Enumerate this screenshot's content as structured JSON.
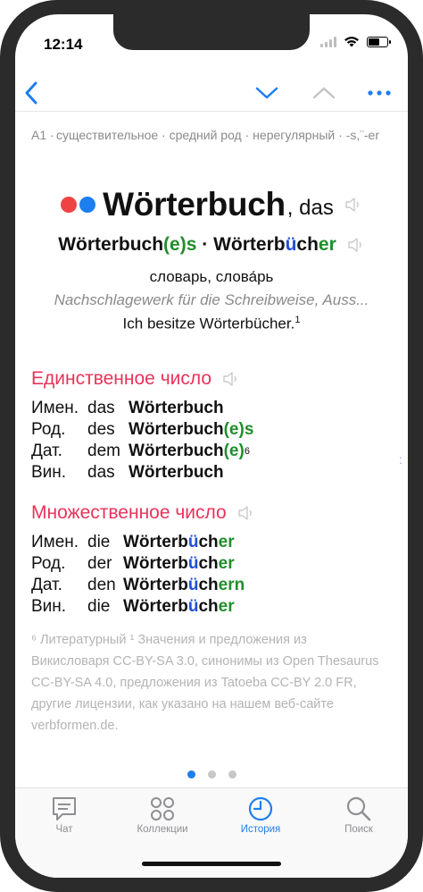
{
  "status_bar": {
    "time": "12:14"
  },
  "entry": {
    "level": "A1 ·",
    "grammar": "существительное · средний род · нерегулярный · -s,¨-er",
    "dots": {
      "left": "#ef4343",
      "right": "#1e7ef0"
    },
    "word": "Wörterbuch",
    "article": ", das",
    "forms": {
      "sg_base": "Wörterbuch",
      "sg_ending": "(e)s",
      "separator": " · ",
      "pl_start": "Wörterb",
      "pl_umlaut": "ü",
      "pl_mid": "ch",
      "pl_ending": "er"
    },
    "translation": "словарь, слова́рь",
    "definition": "Nachschlagewerk für die Schreibweise, Auss...",
    "example": "Ich besitze Wörterbücher.",
    "example_sup": "1"
  },
  "singular": {
    "title": "Единственное число",
    "rows": [
      {
        "case": "Имен.",
        "article": "das",
        "noun": "Wörterbuch",
        "ending": "",
        "sup": ""
      },
      {
        "case": "Род.",
        "article": "des",
        "noun": "Wörterbuch",
        "ending": "(e)s",
        "sup": ""
      },
      {
        "case": "Дат.",
        "article": "dem",
        "noun": "Wörterbuch",
        "ending": "(e)",
        "sup": "6"
      },
      {
        "case": "Вин.",
        "article": "das",
        "noun": "Wörterbuch",
        "ending": "",
        "sup": ""
      }
    ]
  },
  "plural": {
    "title": "Множественное число",
    "rows": [
      {
        "case": "Имен.",
        "article": "die",
        "stem": "Wörterb",
        "umlaut": "ü",
        "mid": "ch",
        "ending": "er"
      },
      {
        "case": "Род.",
        "article": "der",
        "stem": "Wörterb",
        "umlaut": "ü",
        "mid": "ch",
        "ending": "er"
      },
      {
        "case": "Дат.",
        "article": "den",
        "stem": "Wörterb",
        "umlaut": "ü",
        "mid": "ch",
        "ending": "ern"
      },
      {
        "case": "Вин.",
        "article": "die",
        "stem": "Wörterb",
        "umlaut": "ü",
        "mid": "ch",
        "ending": "er"
      }
    ]
  },
  "footnote": "⁶ Литературный ¹ Значения и предложения из Викисловаря CC-BY-SA 3.0, синонимы из Open Thesaurus CC-BY-SA 4.0, предложения из Tatoeba CC-BY 2.0 FR, другие лицензии, как указано на нашем веб-сайте verbformen.de.",
  "side_mark": ":",
  "pager": {
    "count": 3,
    "active": 0
  },
  "tabs": [
    {
      "label": "Чат",
      "icon": "chat-icon"
    },
    {
      "label": "Коллекции",
      "icon": "collections-icon"
    },
    {
      "label": "История",
      "icon": "history-icon"
    },
    {
      "label": "Поиск",
      "icon": "search-icon"
    }
  ],
  "colors": {
    "accent": "#1e7ef0",
    "section": "#e8335a",
    "ending": "#1f8f2a",
    "umlaut": "#1e4fd6"
  }
}
